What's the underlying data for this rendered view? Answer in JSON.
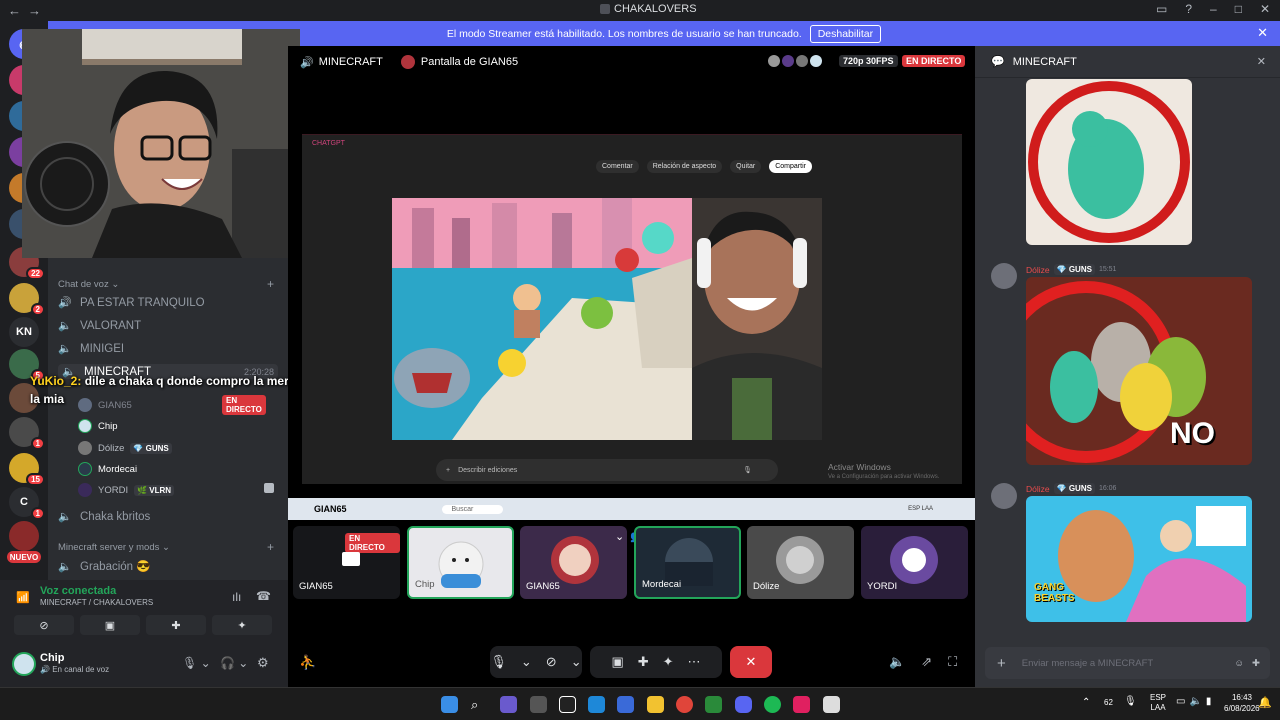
{
  "titlebar": {
    "back": "←",
    "forward": "→",
    "server_name": "CHAKALOVERS"
  },
  "banner": {
    "text": "El modo Streamer está habilitado. Los nombres de usuario se han truncado.",
    "button": "Deshabilitar"
  },
  "servers": [
    "KN",
    "C",
    "NUEVO"
  ],
  "server_badges": [
    "22",
    "2",
    "5",
    "1",
    "15",
    "1"
  ],
  "channels": {
    "section": "Chat de voz",
    "items": [
      "PA ESTAR TRANQUILO",
      "VALORANT",
      "MINIGEI",
      "MINECRAFT"
    ],
    "minecraft_timer": "2:20:28",
    "voice_users": [
      {
        "name": "GIAN65",
        "status": "EN DIRECTO"
      },
      {
        "name": "Chip"
      },
      {
        "name": "Dólize",
        "tag": "GUNS"
      },
      {
        "name": "Mordecai"
      },
      {
        "name": "YORDI",
        "tag": "VLRN"
      }
    ],
    "after": [
      "Chaka kbritos"
    ],
    "section2": "Minecraft server y mods",
    "after2": [
      "Grabación 😎"
    ]
  },
  "chat_overlay": {
    "user": "YuKio_2:",
    "message": "dile a chaka q donde compro la merca, por q no es de la mia"
  },
  "voice_panel": {
    "status": "Voz conectada",
    "location": "MINECRAFT / CHAKALOVERS",
    "user": "Chip",
    "user_status": "En canal de voz"
  },
  "stage": {
    "channel": "MINECRAFT",
    "screen_title": "Pantalla de GIAN65",
    "quality": "720p 30FPS",
    "live": "EN DIRECTO",
    "app_title": "CHATGPT",
    "toolbar": [
      "Comentar",
      "Relación de aspecto",
      "Quitar",
      "Compartir"
    ],
    "prompt_placeholder": "Describir ediciones",
    "activate_title": "Activar Windows",
    "activate_sub": "Ve a Configuración para activar Windows.",
    "inner_search": "Buscar",
    "inner_lang": "ESP",
    "inner_lang2": "LAA",
    "preview_label": "GIAN65"
  },
  "tiles": [
    {
      "name": "GIAN65",
      "live": "EN DIRECTO"
    },
    {
      "name": "Chip"
    },
    {
      "name": "GIAN65"
    },
    {
      "name": "Mordecai"
    },
    {
      "name": "Dólize"
    },
    {
      "name": "YORDI"
    }
  ],
  "right_panel": {
    "title": "MINECRAFT",
    "messages": [
      {
        "user": "Dólize",
        "tag": "GUNS",
        "time": "15:51",
        "image_text": "NO"
      },
      {
        "user": "Dólize",
        "tag": "GUNS",
        "time": "16:06",
        "image_text": "GANG BEASTS"
      }
    ],
    "input_placeholder": "Enviar mensaje a MINECRAFT"
  },
  "taskbar": {
    "time": "16:43",
    "date": "6/08/2026",
    "lang1": "ESP",
    "lang2": "LAA",
    "volume": "62"
  },
  "colors": {
    "accent": "#5865f2",
    "live": "#da373c",
    "connected": "#23a55a"
  }
}
